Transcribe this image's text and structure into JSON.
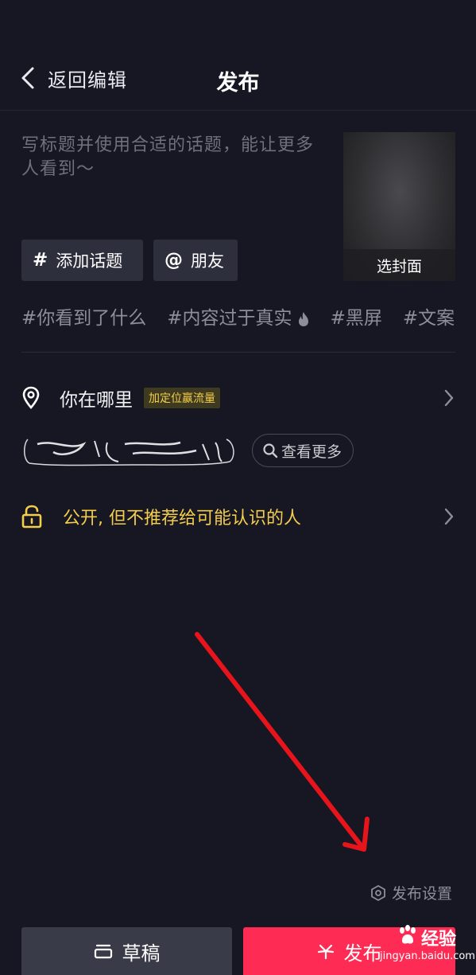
{
  "header": {
    "back_label": "返回编辑",
    "title": "发布"
  },
  "caption": {
    "placeholder": "写标题并使用合适的话题，能让更多人看到～"
  },
  "cover": {
    "label": "选封面"
  },
  "actions": {
    "add_topic": "添加话题",
    "add_topic_symbol": "#",
    "mention_friend": "朋友",
    "mention_symbol": "@"
  },
  "suggested_topics": [
    "#你看到了什么",
    "#内容过于真实",
    "#黑屏",
    "#文案"
  ],
  "location": {
    "label": "你在哪里",
    "badge": "加定位赢流量",
    "more_label": "查看更多"
  },
  "privacy": {
    "label": "公开, 但不推荐给可能认识的人"
  },
  "footer": {
    "settings_label": "发布设置",
    "draft_label": "草稿",
    "publish_label": "发布"
  },
  "watermark": {
    "brand": "经验",
    "url": "jingyan.baidu.com"
  },
  "colors": {
    "background": "#161722",
    "accent_yellow": "#f4cd4b",
    "publish_red": "#fe2c55",
    "annotation_red": "#e8141c"
  },
  "icons": {
    "back": "chevron-left-icon",
    "location": "location-pin-icon",
    "privacy": "unlock-icon",
    "search": "search-icon",
    "settings": "hexagon-settings-icon",
    "draft": "draft-box-icon",
    "publish": "sparkle-icon",
    "fire": "fire-icon"
  }
}
